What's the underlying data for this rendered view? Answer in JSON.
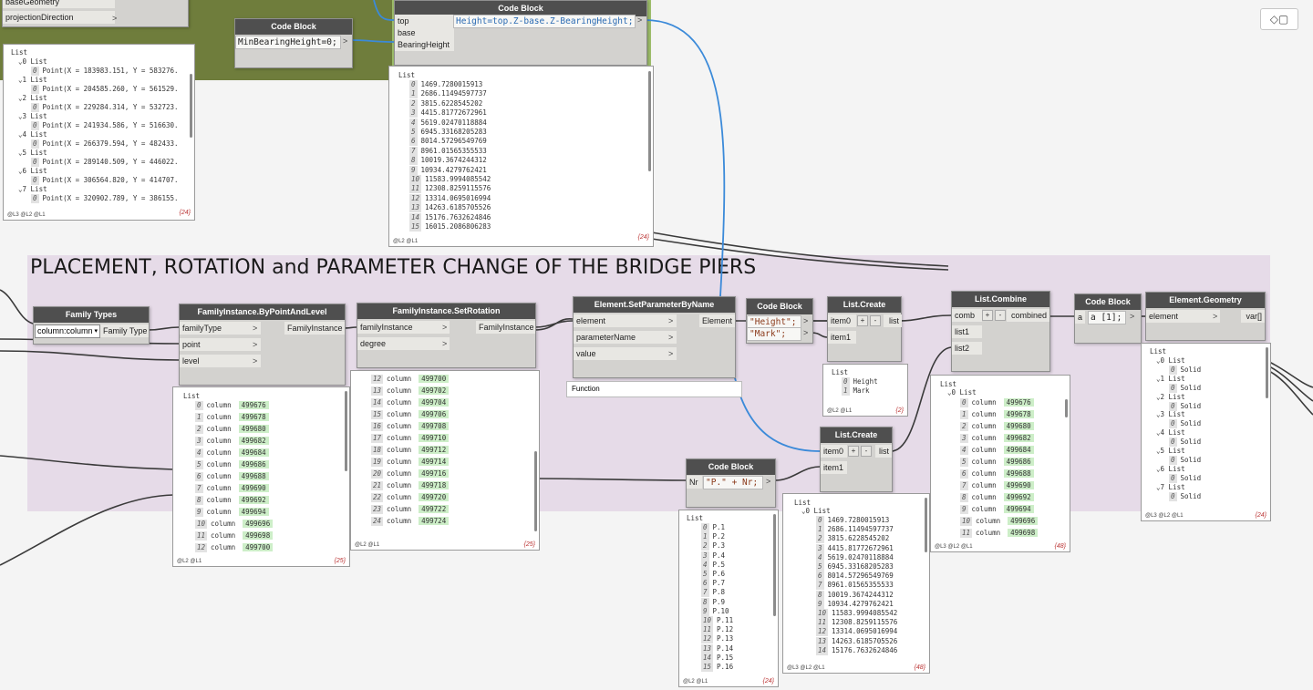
{
  "groups": {
    "placement_title": "PLACEMENT, ROTATION and PARAMETER CHANGE OF THE BRIDGE PIERS"
  },
  "toolbar": {
    "icon": "preview-cube-icon",
    "glyph": "◇▢"
  },
  "nodes": {
    "partial": {
      "port1": "baseGeometry",
      "port2": "projectionDirection"
    },
    "cb_min": {
      "title": "Code Block",
      "code": "MinBearingHeight=0;",
      "out": ">"
    },
    "cb_height": {
      "title": "Code Block",
      "inputs": [
        "top",
        "base",
        "BearingHeight"
      ],
      "code": "Height=top.Z-base.Z-BearingHeight;",
      "out": ">"
    },
    "family_types": {
      "title": "Family Types",
      "selected": "column:column",
      "out": "Family Type"
    },
    "fi_bypoint": {
      "title": "FamilyInstance.ByPointAndLevel",
      "inputs": [
        "familyType",
        "point",
        "level"
      ],
      "out": "FamilyInstance"
    },
    "fi_setrot": {
      "title": "FamilyInstance.SetRotation",
      "inputs": [
        "familyInstance",
        "degree"
      ],
      "out": "FamilyInstance"
    },
    "el_setparam": {
      "title": "Element.SetParameterByName",
      "inputs": [
        "element",
        "parameterName",
        "value"
      ],
      "out": "Element",
      "tooltip": "Function"
    },
    "cb_strings": {
      "title": "Code Block",
      "lines": [
        "\"Height\";",
        "\"Mark\";"
      ]
    },
    "list_create1": {
      "title": "List.Create",
      "inputs": [
        "item0",
        "item1"
      ],
      "out": "list"
    },
    "list_combine": {
      "title": "List.Combine",
      "inputs": [
        "comb",
        "list1",
        "list2"
      ],
      "out": "combined"
    },
    "cb_a1": {
      "title": "Code Block",
      "input": "a",
      "code": "a [1];",
      "out": ">"
    },
    "el_geom": {
      "title": "Element.Geometry",
      "input": "element",
      "out": "var[]"
    },
    "list_create2": {
      "title": "List.Create",
      "inputs": [
        "item0",
        "item1"
      ],
      "out": "list"
    },
    "cb_nr": {
      "title": "Code Block",
      "input": "Nr",
      "code": "\"P.\" + Nr;",
      "out": ">"
    }
  },
  "previews": {
    "points": {
      "header": "List",
      "rows": [
        {
          "t": "⌄0 List",
          "i": 0
        },
        {
          "t": "Point(X = 183983.151, Y = 583276.",
          "i": 1,
          "idx": "0"
        },
        {
          "t": "⌄1 List",
          "i": 0
        },
        {
          "t": "Point(X = 204585.260, Y = 561529.",
          "i": 1,
          "idx": "0"
        },
        {
          "t": "⌄2 List",
          "i": 0
        },
        {
          "t": "Point(X = 229284.314, Y = 532723.",
          "i": 1,
          "idx": "0"
        },
        {
          "t": "⌄3 List",
          "i": 0
        },
        {
          "t": "Point(X = 241934.586, Y = 516630.",
          "i": 1,
          "idx": "0"
        },
        {
          "t": "⌄4 List",
          "i": 0
        },
        {
          "t": "Point(X = 266379.594, Y = 482433.",
          "i": 1,
          "idx": "0"
        },
        {
          "t": "⌄5 List",
          "i": 0
        },
        {
          "t": "Point(X = 289140.509, Y = 446022.",
          "i": 1,
          "idx": "0"
        },
        {
          "t": "⌄6 List",
          "i": 0
        },
        {
          "t": "Point(X = 306564.820, Y = 414707.",
          "i": 1,
          "idx": "0"
        },
        {
          "t": "⌄7 List",
          "i": 0
        },
        {
          "t": "Point(X = 320902.789, Y = 386155.",
          "i": 1,
          "idx": "0"
        }
      ],
      "foot": "@L3 @L2 @L1",
      "count": "{24}"
    },
    "heights": {
      "header": "List",
      "rows": [
        {
          "idx": "0",
          "t": "1469.7280015913"
        },
        {
          "idx": "1",
          "t": "2686.11494597737"
        },
        {
          "idx": "2",
          "t": "3815.6228545202"
        },
        {
          "idx": "3",
          "t": "4415.81772672961"
        },
        {
          "idx": "4",
          "t": "5619.02470118884"
        },
        {
          "idx": "5",
          "t": "6945.33168205283"
        },
        {
          "idx": "6",
          "t": "8014.57296549769"
        },
        {
          "idx": "7",
          "t": "8961.01565355533"
        },
        {
          "idx": "8",
          "t": "10019.3674244312"
        },
        {
          "idx": "9",
          "t": "10934.4279762421"
        },
        {
          "idx": "10",
          "t": "11583.9994085542"
        },
        {
          "idx": "11",
          "t": "12308.8259115576"
        },
        {
          "idx": "12",
          "t": "13314.0695016994"
        },
        {
          "idx": "13",
          "t": "14263.6185705526"
        },
        {
          "idx": "14",
          "t": "15176.7632624846"
        },
        {
          "idx": "15",
          "t": "16015.2086806283"
        }
      ],
      "foot": "@L2 @L1",
      "count": "{24}"
    },
    "fi_list": {
      "header": "List",
      "rows": [
        {
          "idx": "0",
          "t": "column",
          "v": "499676"
        },
        {
          "idx": "1",
          "t": "column",
          "v": "499678"
        },
        {
          "idx": "2",
          "t": "column",
          "v": "499680"
        },
        {
          "idx": "3",
          "t": "column",
          "v": "499682"
        },
        {
          "idx": "4",
          "t": "column",
          "v": "499684"
        },
        {
          "idx": "5",
          "t": "column",
          "v": "499686"
        },
        {
          "idx": "6",
          "t": "column",
          "v": "499688"
        },
        {
          "idx": "7",
          "t": "column",
          "v": "499690"
        },
        {
          "idx": "8",
          "t": "column",
          "v": "499692"
        },
        {
          "idx": "9",
          "t": "column",
          "v": "499694"
        },
        {
          "idx": "10",
          "t": "column",
          "v": "499696"
        },
        {
          "idx": "11",
          "t": "column",
          "v": "499698"
        },
        {
          "idx": "12",
          "t": "column",
          "v": "499700"
        }
      ],
      "foot": "@L2 @L1",
      "count": "{25}"
    },
    "rot_list": {
      "rows": [
        {
          "idx": "12",
          "t": "column",
          "v": "499700"
        },
        {
          "idx": "13",
          "t": "column",
          "v": "499702"
        },
        {
          "idx": "14",
          "t": "column",
          "v": "499704"
        },
        {
          "idx": "15",
          "t": "column",
          "v": "499706"
        },
        {
          "idx": "16",
          "t": "column",
          "v": "499708"
        },
        {
          "idx": "17",
          "t": "column",
          "v": "499710"
        },
        {
          "idx": "18",
          "t": "column",
          "v": "499712"
        },
        {
          "idx": "19",
          "t": "column",
          "v": "499714"
        },
        {
          "idx": "20",
          "t": "column",
          "v": "499716"
        },
        {
          "idx": "21",
          "t": "column",
          "v": "499718"
        },
        {
          "idx": "22",
          "t": "column",
          "v": "499720"
        },
        {
          "idx": "23",
          "t": "column",
          "v": "499722"
        },
        {
          "idx": "24",
          "t": "column",
          "v": "499724"
        }
      ],
      "foot": "@L2 @L1",
      "count": "{25}"
    },
    "names": {
      "header": "List",
      "rows": [
        {
          "idx": "0",
          "t": "Height"
        },
        {
          "idx": "1",
          "t": "Mark"
        }
      ],
      "foot": "@L2 @L1",
      "count": "{2}"
    },
    "combined": {
      "header": "List",
      "sub": "⌄0 List",
      "rows": [
        {
          "idx": "0",
          "t": "column",
          "v": "499676"
        },
        {
          "idx": "1",
          "t": "column",
          "v": "499678"
        },
        {
          "idx": "2",
          "t": "column",
          "v": "499680"
        },
        {
          "idx": "3",
          "t": "column",
          "v": "499682"
        },
        {
          "idx": "4",
          "t": "column",
          "v": "499684"
        },
        {
          "idx": "5",
          "t": "column",
          "v": "499686"
        },
        {
          "idx": "6",
          "t": "column",
          "v": "499688"
        },
        {
          "idx": "7",
          "t": "column",
          "v": "499690"
        },
        {
          "idx": "8",
          "t": "column",
          "v": "499692"
        },
        {
          "idx": "9",
          "t": "column",
          "v": "499694"
        },
        {
          "idx": "10",
          "t": "column",
          "v": "499696"
        },
        {
          "idx": "11",
          "t": "column",
          "v": "499698"
        }
      ],
      "foot": "@L3 @L2 @L1",
      "count": "{48}"
    },
    "geometry": {
      "header": "List",
      "rows": [
        {
          "t": "⌄0 List",
          "i": 0
        },
        {
          "idx": "0",
          "t": "Solid",
          "i": 1
        },
        {
          "t": "⌄1 List",
          "i": 0
        },
        {
          "idx": "0",
          "t": "Solid",
          "i": 1
        },
        {
          "t": "⌄2 List",
          "i": 0
        },
        {
          "idx": "0",
          "t": "Solid",
          "i": 1
        },
        {
          "t": "⌄3 List",
          "i": 0
        },
        {
          "idx": "0",
          "t": "Solid",
          "i": 1
        },
        {
          "t": "⌄4 List",
          "i": 0
        },
        {
          "idx": "0",
          "t": "Solid",
          "i": 1
        },
        {
          "t": "⌄5 List",
          "i": 0
        },
        {
          "idx": "0",
          "t": "Solid",
          "i": 1
        },
        {
          "t": "⌄6 List",
          "i": 0
        },
        {
          "idx": "0",
          "t": "Solid",
          "i": 1
        },
        {
          "t": "⌄7 List",
          "i": 0
        },
        {
          "idx": "0",
          "t": "Solid",
          "i": 1
        }
      ],
      "foot": "@L3 @L2 @L1",
      "count": "{24}"
    },
    "mark_values": {
      "header": "List",
      "rows": [
        {
          "idx": "0",
          "t": "P.1"
        },
        {
          "idx": "1",
          "t": "P.2"
        },
        {
          "idx": "2",
          "t": "P.3"
        },
        {
          "idx": "3",
          "t": "P.4"
        },
        {
          "idx": "4",
          "t": "P.5"
        },
        {
          "idx": "5",
          "t": "P.6"
        },
        {
          "idx": "6",
          "t": "P.7"
        },
        {
          "idx": "7",
          "t": "P.8"
        },
        {
          "idx": "8",
          "t": "P.9"
        },
        {
          "idx": "9",
          "t": "P.10"
        },
        {
          "idx": "10",
          "t": "P.11"
        },
        {
          "idx": "11",
          "t": "P.12"
        },
        {
          "idx": "12",
          "t": "P.13"
        },
        {
          "idx": "13",
          "t": "P.14"
        },
        {
          "idx": "14",
          "t": "P.15"
        },
        {
          "idx": "15",
          "t": "P.16"
        }
      ],
      "foot": "@L2 @L1",
      "count": "{24}"
    },
    "list2": {
      "header": "List",
      "sub": "⌄0 List",
      "rows": [
        {
          "idx": "0",
          "t": "1469.7280015913"
        },
        {
          "idx": "1",
          "t": "2686.11494597737"
        },
        {
          "idx": "2",
          "t": "3815.6228545202"
        },
        {
          "idx": "3",
          "t": "4415.81772672961"
        },
        {
          "idx": "4",
          "t": "5619.02470118884"
        },
        {
          "idx": "5",
          "t": "6945.33168205283"
        },
        {
          "idx": "6",
          "t": "8014.57296549769"
        },
        {
          "idx": "7",
          "t": "8961.01565355533"
        },
        {
          "idx": "8",
          "t": "10019.3674244312"
        },
        {
          "idx": "9",
          "t": "10934.4279762421"
        },
        {
          "idx": "10",
          "t": "11583.9994085542"
        },
        {
          "idx": "11",
          "t": "12308.8259115576"
        },
        {
          "idx": "12",
          "t": "13314.0695016994"
        },
        {
          "idx": "13",
          "t": "14263.6185705526"
        },
        {
          "idx": "14",
          "t": "15176.7632624846"
        }
      ],
      "foot": "@L3 @L2 @L1",
      "count": "{48}"
    }
  }
}
